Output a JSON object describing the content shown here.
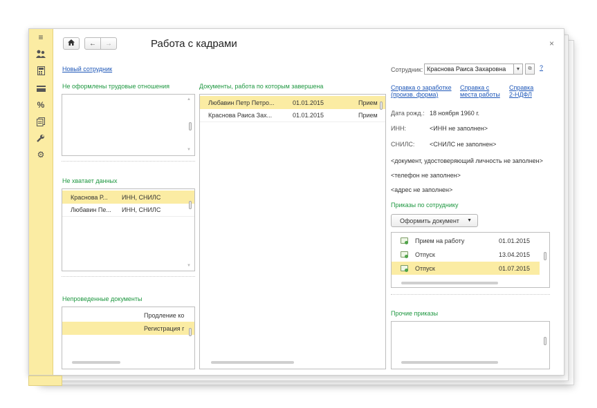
{
  "window": {
    "title": "Работа с кадрами",
    "close_glyph": "×"
  },
  "nav": {
    "home_glyph": "⌂",
    "back_glyph": "←",
    "forward_glyph": "→"
  },
  "sidebar": {
    "items": [
      {
        "name": "menu-icon",
        "glyph": "≡"
      },
      {
        "name": "users-icon",
        "glyph": "👥"
      },
      {
        "name": "calculator-icon",
        "glyph": "▦"
      },
      {
        "name": "card-icon",
        "glyph": "▬"
      },
      {
        "name": "percent-icon",
        "glyph": "%"
      },
      {
        "name": "documents-icon",
        "glyph": "▤"
      },
      {
        "name": "wrench-icon",
        "glyph": "🔧"
      },
      {
        "name": "gear-icon",
        "glyph": "⚙"
      }
    ]
  },
  "left": {
    "new_employee_link": "Новый сотрудник",
    "no_employment_title": "Не оформлены трудовые отношения",
    "missing_data_title": "Не хватает данных",
    "missing_data_rows": [
      {
        "name": "Краснова Р...",
        "missing": "ИНН, СНИЛС"
      },
      {
        "name": "Любавин Пе...",
        "missing": "ИНН, СНИЛС"
      }
    ],
    "unposted_title": "Непроведенные документы",
    "unposted_rows": [
      {
        "text": "Продление ко"
      },
      {
        "text": "Регистрация г"
      }
    ]
  },
  "middle": {
    "title": "Документы, работа по которым завершена",
    "rows": [
      {
        "name": "Любавин Петр Петро...",
        "date": "01.01.2015",
        "type": "Прием"
      },
      {
        "name": "Краснова Раиса Зах...",
        "date": "01.01.2015",
        "type": "Прием"
      }
    ]
  },
  "right": {
    "employee_label": "Сотрудник:",
    "employee_value": "Краснова Раиса Захаровна",
    "help_glyph": "?",
    "links": [
      {
        "line1": "Справка о заработке",
        "line2": "(произв. форма)"
      },
      {
        "line1": "Справка с",
        "line2": "места работы"
      },
      {
        "line1": "Справка",
        "line2": "2-НДФЛ"
      }
    ],
    "birth_label": "Дата рожд.:",
    "birth_value": "18 ноября 1960 г.",
    "inn_label": "ИНН:",
    "inn_value": "<ИНН не заполнен>",
    "snils_label": "СНИЛС:",
    "snils_value": "<СНИЛС не заполнен>",
    "doc_missing": "<документ, удостоверяющий личность не заполнен>",
    "phone_missing": "<телефон не заполнен>",
    "address_missing": "<адрес не заполнен>",
    "orders_title": "Приказы по сотруднику",
    "create_doc_button": "Оформить документ",
    "orders": [
      {
        "name": "Прием на работу",
        "date": "01.01.2015"
      },
      {
        "name": "Отпуск",
        "date": "13.04.2015"
      },
      {
        "name": "Отпуск",
        "date": "01.07.2015"
      }
    ],
    "other_orders_title": "Прочие приказы"
  }
}
